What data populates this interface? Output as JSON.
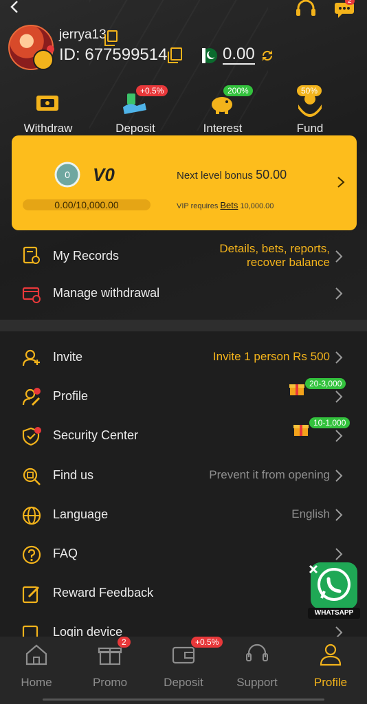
{
  "profile": {
    "username": "jerrya13",
    "id_label": "ID:",
    "id_value": "677599514",
    "balance": "0.00"
  },
  "quick_actions": [
    {
      "label": "Withdraw",
      "badge": "",
      "icon": "withdraw-icon"
    },
    {
      "label": "Deposit",
      "badge": "+0.5%",
      "icon": "deposit-icon"
    },
    {
      "label": "Interest",
      "badge": "200%",
      "icon": "piggy-bank-icon"
    },
    {
      "label": "Fund",
      "badge": "50%",
      "icon": "fund-icon"
    }
  ],
  "vip": {
    "medal_level": "0",
    "level": "V0",
    "progress_text": "0.00/10,000.00",
    "progress": 0,
    "next_label": "Next level bonus",
    "next_value": "50.00",
    "req_label": "VIP requires",
    "req_link": "Bets",
    "req_value": "10,000.00"
  },
  "records": {
    "my_records": {
      "label": "My Records",
      "value_line1": "Details, bets, reports,",
      "value_line2": "recover balance"
    },
    "manage_withdrawal": {
      "label": "Manage withdrawal"
    }
  },
  "menu": {
    "invite": {
      "label": "Invite",
      "value": "Invite 1 person Rs 500"
    },
    "profile": {
      "label": "Profile",
      "reward": "20-3,000"
    },
    "security": {
      "label": "Security Center",
      "reward": "10-1,000"
    },
    "find_us": {
      "label": "Find us",
      "value": "Prevent it from opening"
    },
    "language": {
      "label": "Language",
      "value": "English"
    },
    "faq": {
      "label": "FAQ"
    },
    "feedback": {
      "label": "Reward Feedback"
    },
    "login_device": {
      "label": "Login device"
    }
  },
  "notifications": {
    "chat_count": "2"
  },
  "whatsapp": {
    "label": "WHATSAPP"
  },
  "tabs": [
    {
      "label": "Home",
      "badge": ""
    },
    {
      "label": "Promo",
      "badge": "2"
    },
    {
      "label": "Deposit",
      "badge": "+0.5%"
    },
    {
      "label": "Support",
      "badge": ""
    },
    {
      "label": "Profile",
      "badge": ""
    }
  ],
  "colors": {
    "accent": "#f3b31b",
    "background": "#1f1f1f",
    "badge_red": "#e8383a",
    "badge_green": "#33c23d"
  }
}
